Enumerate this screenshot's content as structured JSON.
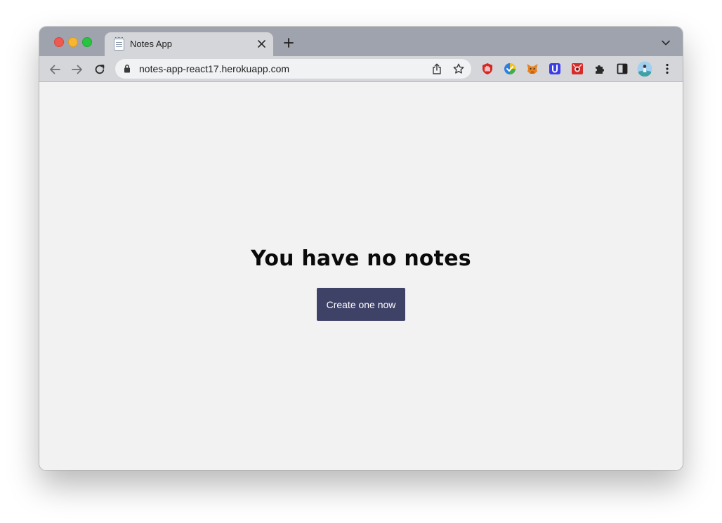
{
  "browser": {
    "tab": {
      "title": "Notes App",
      "favicon": "notepad-icon"
    },
    "address_bar": {
      "url": "notes-app-react17.herokuapp.com"
    },
    "icons": {
      "back": "arrow-left-icon",
      "forward": "arrow-right-icon",
      "reload": "reload-icon",
      "lock": "lock-icon",
      "share": "share-icon",
      "bookmark": "star-icon",
      "extensions": [
        "ublock-extension-icon",
        "colorful-extension-icon",
        "metamask-fox-icon",
        "blue-u-extension-icon",
        "red-extension-icon",
        "puzzle-extensions-icon",
        "side-panel-icon",
        "profile-avatar",
        "kebab-menu-icon"
      ]
    },
    "colors": {
      "tab_strip": "#9fa3ad",
      "toolbar": "#d5d6da"
    }
  },
  "page": {
    "empty_state": {
      "title": "You have no notes",
      "button_label": "Create one now"
    },
    "colors": {
      "background": "#f2f2f2",
      "button": "#3f4267",
      "button_text": "#ffffff"
    }
  }
}
